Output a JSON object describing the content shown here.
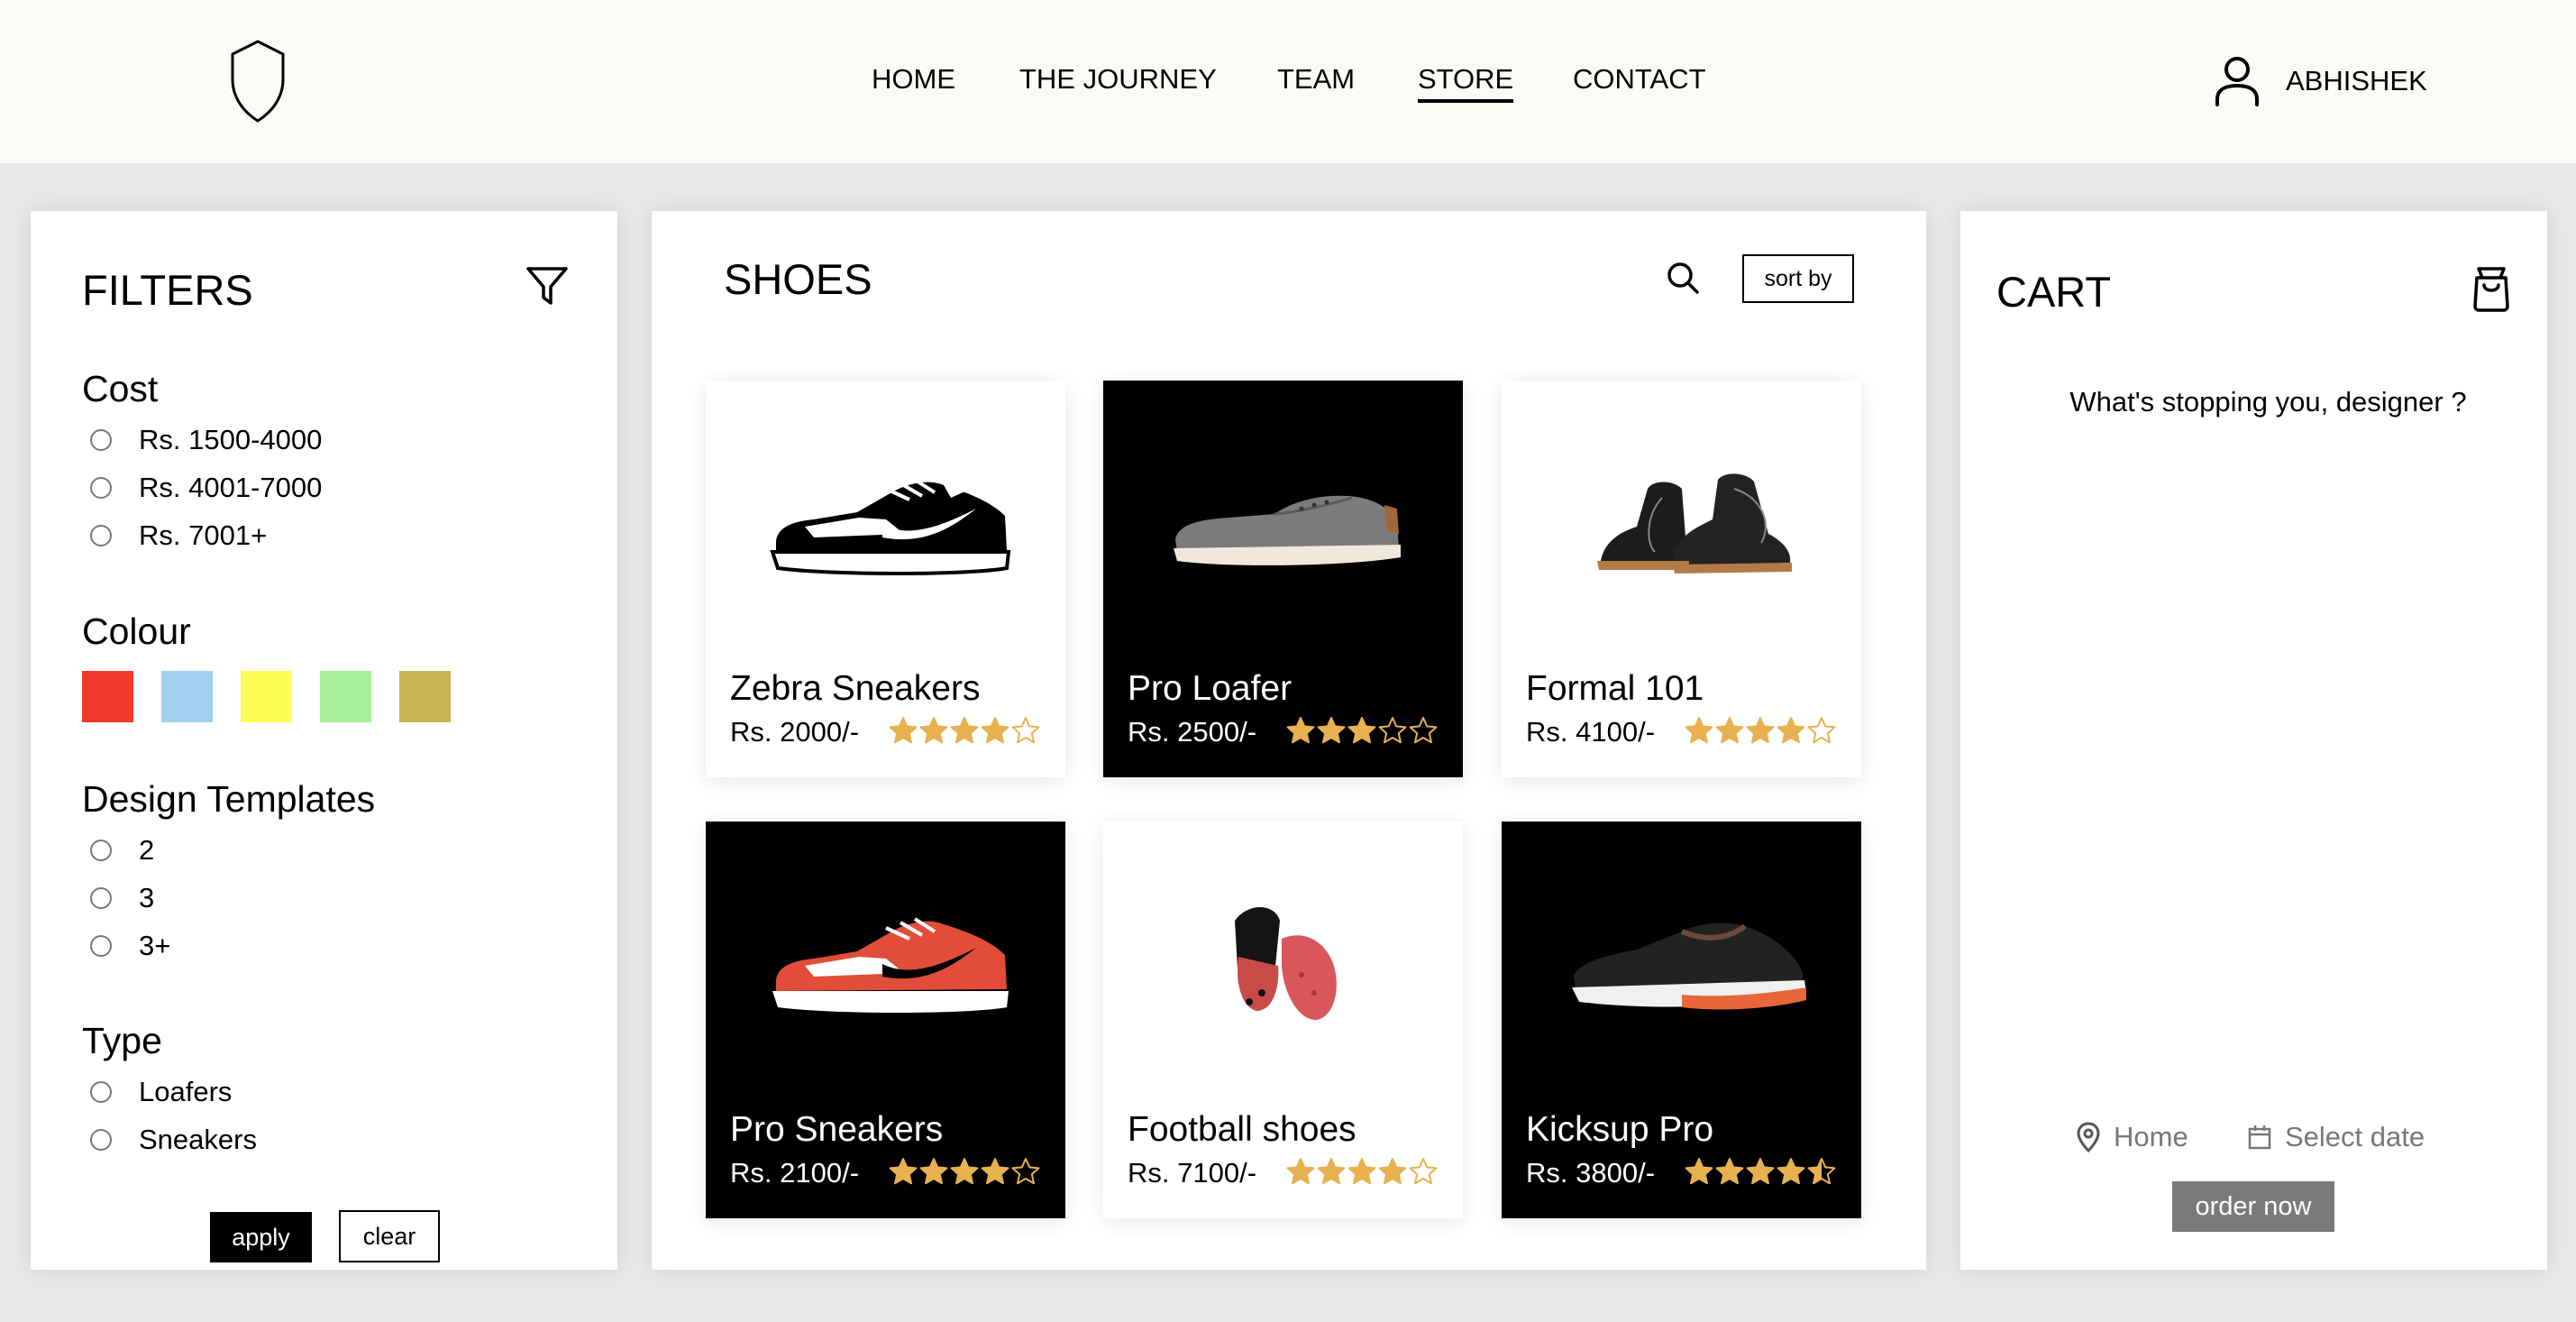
{
  "nav": {
    "items": [
      {
        "label": "HOME",
        "active": false
      },
      {
        "label": "THE JOURNEY",
        "active": false
      },
      {
        "label": "TEAM",
        "active": false
      },
      {
        "label": "STORE",
        "active": true
      },
      {
        "label": "CONTACT",
        "active": false
      }
    ],
    "user": "ABHISHEK"
  },
  "filters": {
    "title": "FILTERS",
    "cost": {
      "title": "Cost",
      "options": [
        "Rs. 1500-4000",
        "Rs. 4001-7000",
        "Rs. 7001+"
      ]
    },
    "colour": {
      "title": "Colour",
      "swatches": [
        "#f03a2b",
        "#9fd0ee",
        "#fdfd55",
        "#a9ee99",
        "#cbb552"
      ]
    },
    "design": {
      "title": "Design Templates",
      "options": [
        "2",
        "3",
        "3+"
      ]
    },
    "type": {
      "title": "Type",
      "options": [
        "Loafers",
        "Sneakers"
      ]
    },
    "apply_label": "apply",
    "clear_label": "clear"
  },
  "shoes": {
    "title": "SHOES",
    "sort_label": "sort by",
    "products": [
      {
        "name": "Zebra Sneakers",
        "price": "Rs. 2000/-",
        "rating": 4,
        "theme": "light"
      },
      {
        "name": "Pro Loafer",
        "price": "Rs. 2500/-",
        "rating": 3,
        "theme": "dark"
      },
      {
        "name": "Formal 101",
        "price": "Rs. 4100/-",
        "rating": 4,
        "theme": "light"
      },
      {
        "name": "Pro Sneakers",
        "price": "Rs. 2100/-",
        "rating": 4,
        "theme": "dark"
      },
      {
        "name": "Football shoes",
        "price": "Rs. 7100/-",
        "rating": 4,
        "theme": "light"
      },
      {
        "name": "Kicksup Pro",
        "price": "Rs. 3800/-",
        "rating": 4.5,
        "theme": "dark"
      }
    ]
  },
  "cart": {
    "title": "CART",
    "message": "What's stopping you, designer ?",
    "location": "Home",
    "date_placeholder": "Select date",
    "order_label": "order now"
  },
  "colors": {
    "star": "#e8b14f",
    "order_button": "#7a7a7a"
  }
}
